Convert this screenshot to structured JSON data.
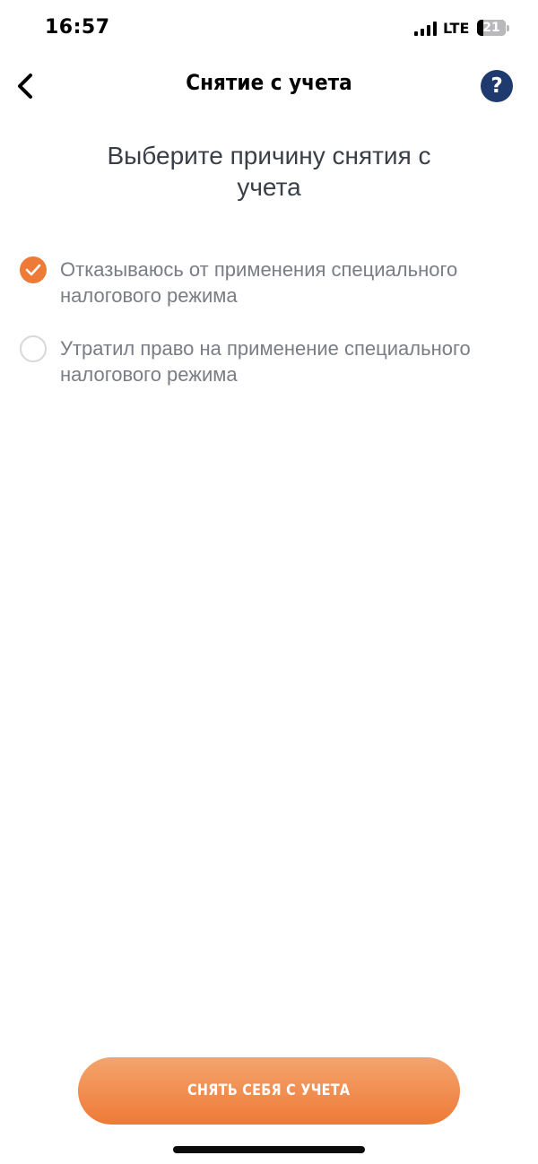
{
  "status_bar": {
    "time": "16:57",
    "network": "LTE",
    "battery_level": "21",
    "battery_fraction": 0.21
  },
  "nav": {
    "title": "Снятие с учета",
    "help_label": "?",
    "back_icon": "chevron-left-icon",
    "help_icon": "question-icon"
  },
  "heading": "Выберите причину снятия с учета",
  "options": [
    {
      "label": "Отказываюсь от применения специального налогового режима",
      "selected": true
    },
    {
      "label": "Утратил право на применение специального налогового режима",
      "selected": false
    }
  ],
  "action_button": {
    "label": "СНЯТЬ СЕБЯ С УЧЕТА"
  },
  "colors": {
    "accent": "#ee7a37",
    "help_bg": "#1f3a6e",
    "option_text": "#7a7d85"
  }
}
